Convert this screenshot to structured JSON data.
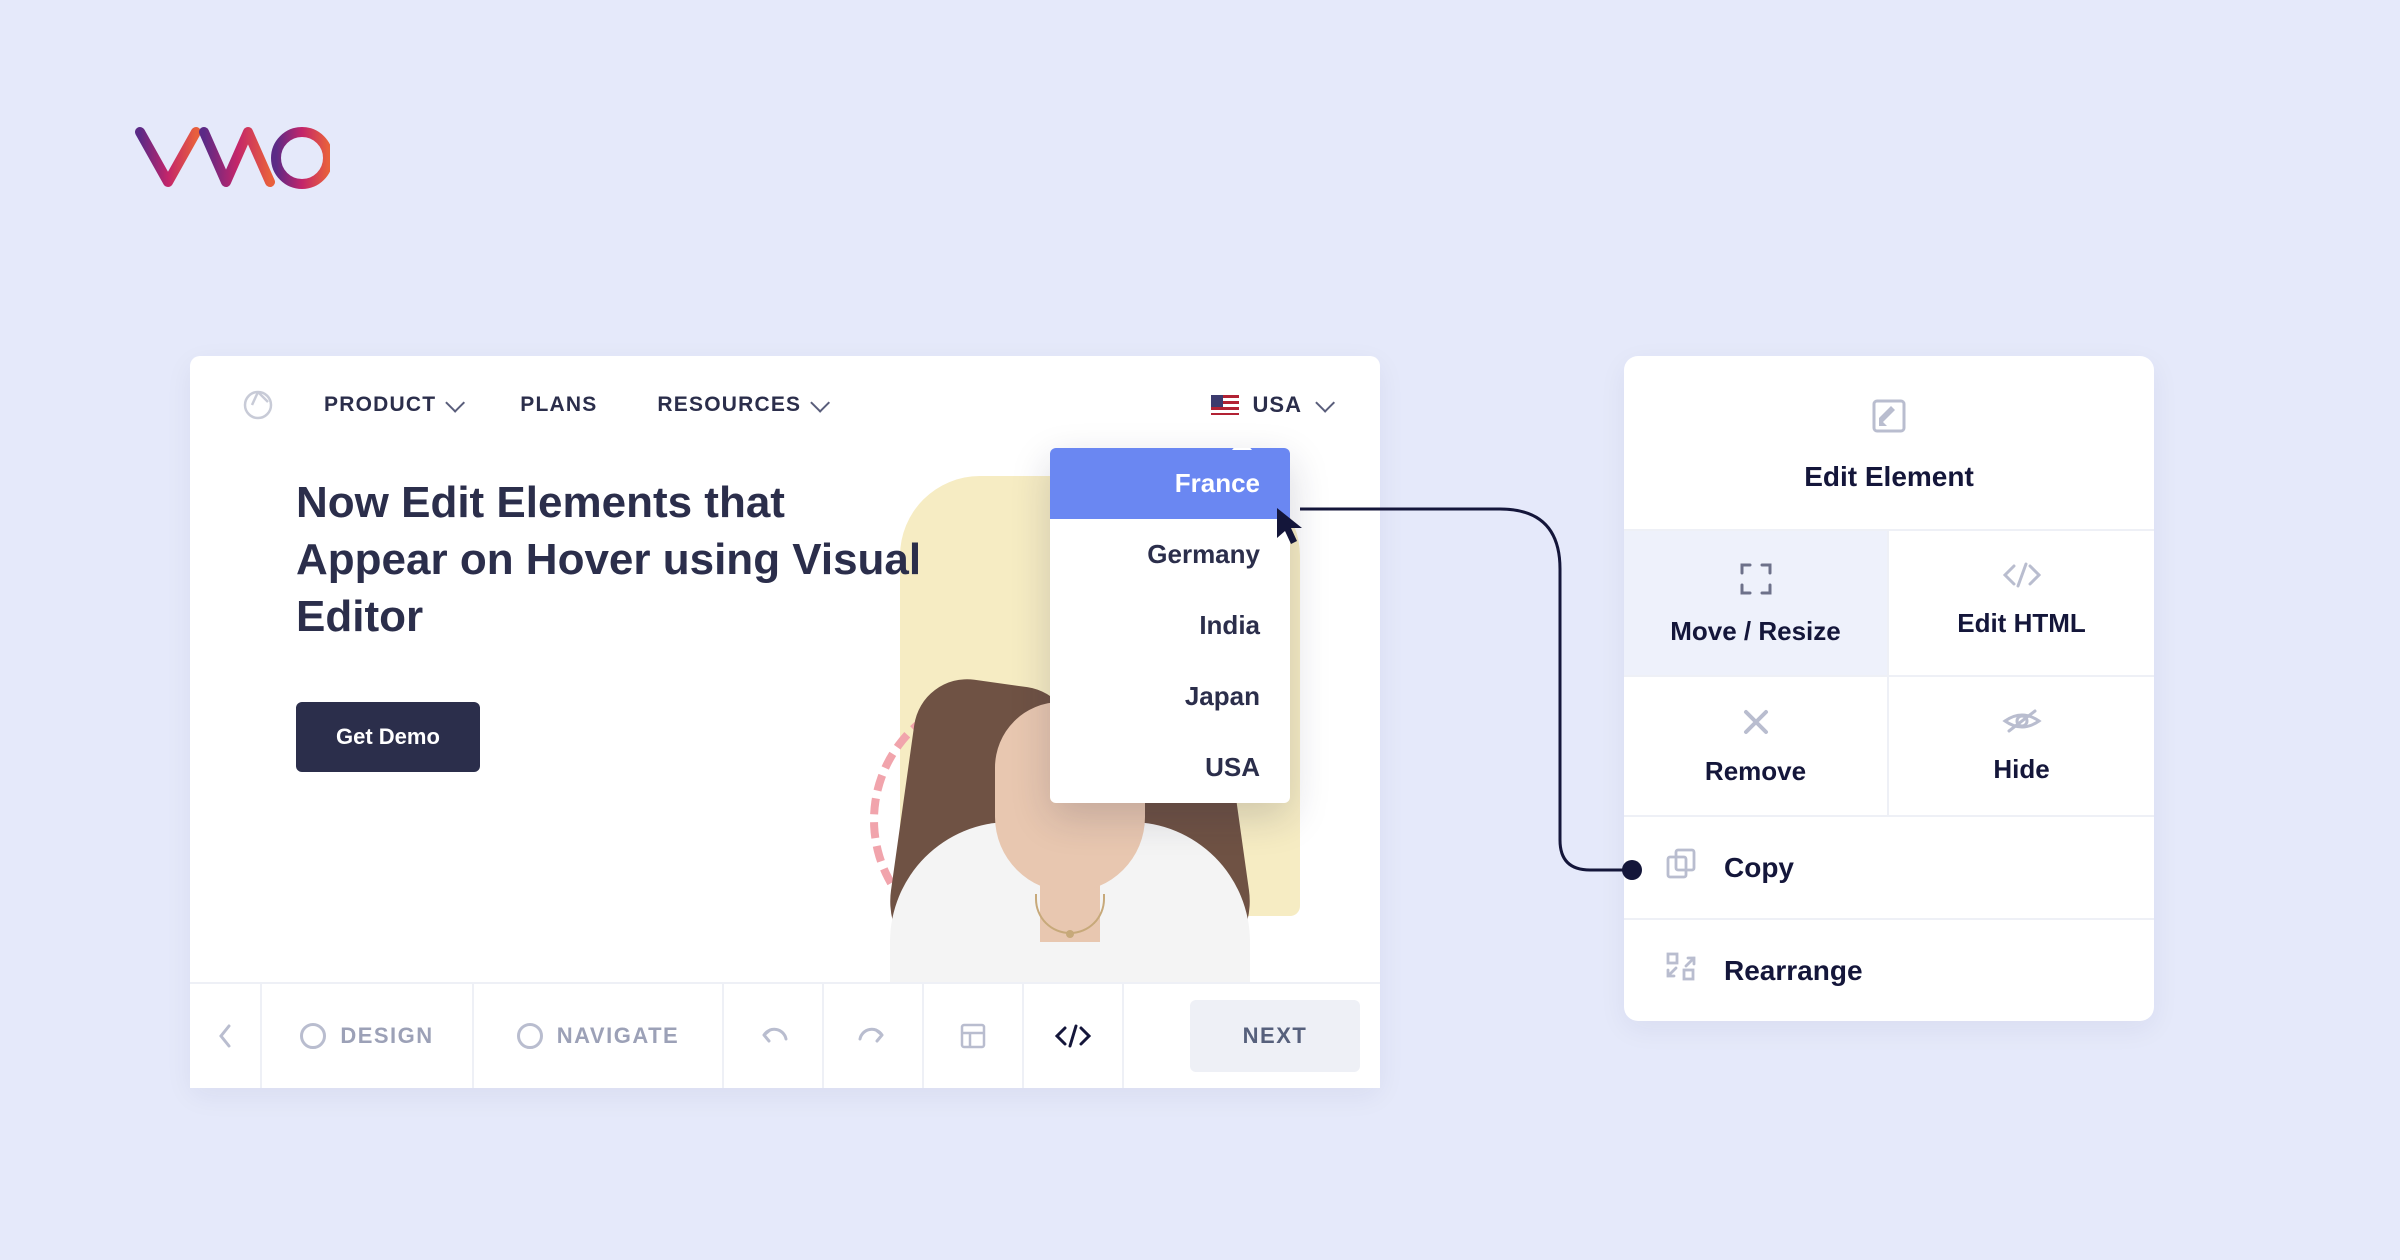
{
  "logo": "VWO",
  "nav": {
    "items": [
      "PRODUCT",
      "PLANS",
      "RESOURCES"
    ],
    "country": "USA"
  },
  "hero": {
    "headline": "Now Edit Elements that Appear on Hover using Visual Editor",
    "cta": "Get Demo"
  },
  "dropdown": {
    "selected": "France",
    "items": [
      "France",
      "Germany",
      "India",
      "Japan",
      "USA"
    ]
  },
  "toolbar": {
    "design": "DESIGN",
    "navigate": "NAVIGATE",
    "next": "NEXT"
  },
  "context_panel": {
    "title": "Edit Element",
    "move_resize": "Move / Resize",
    "edit_html": "Edit HTML",
    "remove": "Remove",
    "hide": "Hide",
    "copy": "Copy",
    "rearrange": "Rearrange"
  }
}
